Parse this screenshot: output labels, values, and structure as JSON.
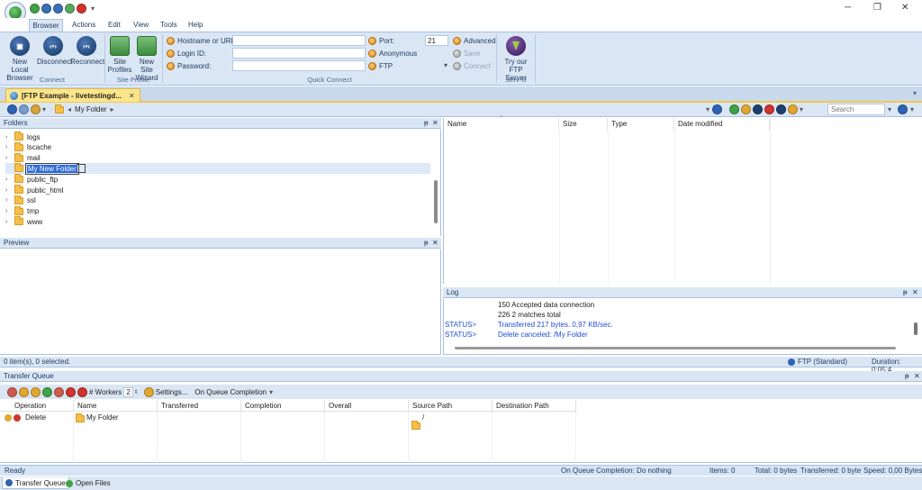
{
  "title_bar": {
    "quick_access_arrow": "▾",
    "win_min": "─",
    "win_restore": "❐",
    "win_close": "✕"
  },
  "ribbon_tabs": [
    "Browser",
    "Actions",
    "Edit",
    "View",
    "Tools",
    "Help"
  ],
  "ribbon": {
    "connect": {
      "new_local_browser": "New Local Browser",
      "disconnect": "Disconnect",
      "reconnect": "Reconnect",
      "group_label": "Connect"
    },
    "site_profile": {
      "site_profiles": "Site Profiles",
      "new_site_wizard": "New Site Wizard",
      "group_label": "Site Profile"
    },
    "quick_connect": {
      "hostname_label": "Hostname or URL:",
      "login_label": "Login ID:",
      "password_label": "Password:",
      "port_label": "Port:",
      "port_value": "21",
      "anonymous_label": "Anonymous",
      "protocol_label": "FTP",
      "advanced": "Advanced",
      "save": "Save",
      "connect": "Connect",
      "group_label": "Quick Connect"
    },
    "servu": {
      "try_label": "Try our FTP Server",
      "group_label": "Serv-U"
    }
  },
  "doc_tab": {
    "label": "[FTP Example - livetestingd...",
    "close": "✕"
  },
  "nav": {
    "path": "My Folder",
    "search_placeholder": "Search"
  },
  "folders": {
    "title": "Folders",
    "items": [
      {
        "name": "logs",
        "chev": "›"
      },
      {
        "name": "lscache",
        "chev": "›"
      },
      {
        "name": "mail",
        "chev": "›"
      },
      {
        "name": "My New Folder",
        "chev": ""
      },
      {
        "name": "public_ftp",
        "chev": "›"
      },
      {
        "name": "public_html",
        "chev": "›"
      },
      {
        "name": "ssl",
        "chev": "›"
      },
      {
        "name": "tmp",
        "chev": "›"
      },
      {
        "name": "www",
        "chev": "›"
      }
    ]
  },
  "preview": {
    "title": "Preview"
  },
  "file_list": {
    "columns": [
      "Name",
      "Size",
      "Type",
      "Date modified"
    ],
    "sort_glyph": "^"
  },
  "log": {
    "title": "Log",
    "lines": [
      {
        "prefix": "",
        "text": "150 Accepted data connection",
        "color": "#1e1e1e"
      },
      {
        "prefix": "",
        "text": "226 2 matches total",
        "color": "#1e1e1e"
      },
      {
        "prefix": "STATUS>",
        "text": "Transferred 217 bytes. 0,97 KB/sec.",
        "color": "#1f4fd1"
      },
      {
        "prefix": "STATUS>",
        "text": "Delete canceled: /My Folder",
        "color": "#1f4fd1"
      }
    ]
  },
  "browser_status": {
    "left": "0 item(s), 0 selected.",
    "protocol": "FTP (Standard)",
    "duration": "Duration: 0:05:4"
  },
  "transfer_queue": {
    "title": "Transfer Queue",
    "workers_label": "# Workers",
    "workers_value": "2",
    "settings": "Settings...",
    "on_queue_completion": "On Queue Completion",
    "columns": [
      "Operation",
      "Name",
      "Transferred",
      "Completion",
      "Overall",
      "Source Path",
      "Destination Path"
    ],
    "rows": [
      {
        "operation": "Delete",
        "name": "My Folder",
        "transferred": "",
        "completion": "",
        "overall": "",
        "source": "/",
        "destination": ""
      }
    ]
  },
  "status_bar": {
    "ready": "Ready",
    "on_completion": "On Queue Completion: Do nothing",
    "items": "Items: 0",
    "total": "Total: 0 bytes",
    "transferred": "Transferred: 0 byte",
    "speed": "Speed: 0,00 Bytes/s"
  },
  "bottom_tabs": [
    "Transfer Queue",
    "Open Files"
  ],
  "colors": {
    "accent": "#1e395b",
    "panel": "#dae6f4",
    "tab_active": "#fde58a",
    "status_blue": "#1f4fd1"
  }
}
